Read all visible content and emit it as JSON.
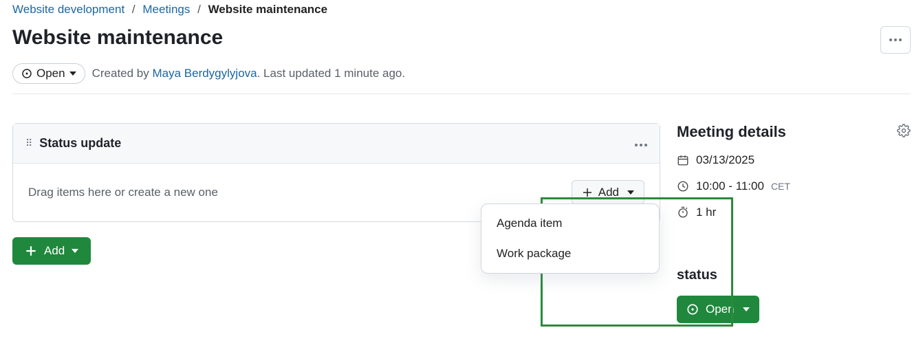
{
  "breadcrumb": {
    "parent": "Website development",
    "section": "Meetings",
    "current": "Website maintenance"
  },
  "title": "Website maintenance",
  "status_pill_label": "Open",
  "meta_line": {
    "created_prefix": "Created by ",
    "author": "Maya Berdygylyjova",
    "updated_suffix": ". Last updated 1 minute ago."
  },
  "agenda": {
    "section_title": "Status update",
    "empty_text": "Drag items here or create a new one",
    "add_button": "Add",
    "menu": [
      "Agenda item",
      "Work package"
    ]
  },
  "main_add_button": "Add",
  "details": {
    "heading": "Meeting details",
    "date": "03/13/2025",
    "time": "10:00 - 11:00",
    "timezone": "CET",
    "duration": "1 hr"
  },
  "status_section": {
    "heading": "status",
    "button": "Open"
  }
}
